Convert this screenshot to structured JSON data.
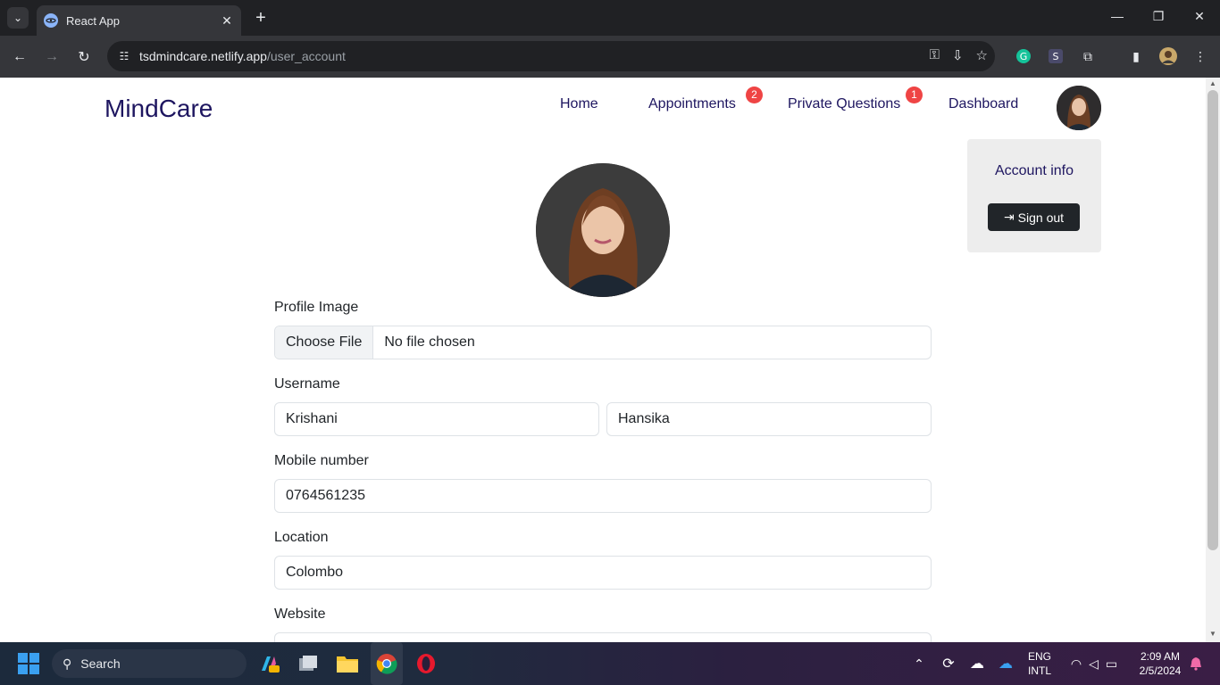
{
  "browser": {
    "tab_title": "React App",
    "url_host": "tsdmindcare.netlify.app",
    "url_path": "/user_account",
    "new_tab_label": "+"
  },
  "nav": {
    "brand": "MindCare",
    "links": [
      {
        "label": "Home"
      },
      {
        "label": "Appointments",
        "badge": "2"
      },
      {
        "label": "Private Questions",
        "badge": "1"
      },
      {
        "label": "Dashboard"
      }
    ]
  },
  "account_menu": {
    "info_label": "Account info",
    "signout_label": "Sign out"
  },
  "form": {
    "profile_image_label": "Profile Image",
    "file_button": "Choose File",
    "file_status": "No file chosen",
    "username_label": "Username",
    "first_name": "Krishani",
    "last_name": "Hansika",
    "mobile_label": "Mobile number",
    "mobile": "0764561235",
    "location_label": "Location",
    "location": "Colombo",
    "website_label": "Website",
    "website": ""
  },
  "taskbar": {
    "search_placeholder": "Search",
    "lang_top": "ENG",
    "lang_bottom": "INTL",
    "time": "2:09 AM",
    "date": "2/5/2024"
  },
  "colors": {
    "brand": "#1e1660",
    "badge": "#ef4444",
    "dark_button": "#212529"
  }
}
